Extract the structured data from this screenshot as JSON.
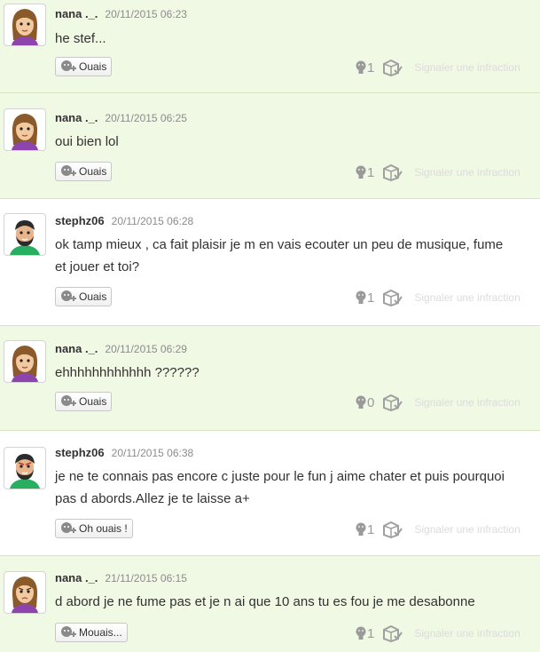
{
  "posts": [
    {
      "author": "nana ._.",
      "timestamp": "20/11/2015 06:23",
      "text": "he stef...",
      "reaction_label": "Ouais",
      "empathy_count": "1",
      "report_label": "Signaler une infraction",
      "avatar": "female-mii-avatar",
      "bg": "green"
    },
    {
      "author": "nana ._.",
      "timestamp": "20/11/2015 06:25",
      "text": "oui bien lol",
      "reaction_label": "Ouais",
      "empathy_count": "1",
      "report_label": "Signaler une infraction",
      "avatar": "female-mii-avatar",
      "bg": "green"
    },
    {
      "author": "stephz06",
      "timestamp": "20/11/2015 06:28",
      "text": "ok tamp mieux , ca fait plaisir je m en vais ecouter un peu de musique, fume et jouer et toi?",
      "reaction_label": "Ouais",
      "empathy_count": "1",
      "report_label": "Signaler une infraction",
      "avatar": "male-mii-avatar",
      "bg": "white"
    },
    {
      "author": "nana ._.",
      "timestamp": "20/11/2015 06:29",
      "text": "ehhhhhhhhhhhh ??????",
      "reaction_label": "Ouais",
      "empathy_count": "0",
      "report_label": "Signaler une infraction",
      "avatar": "female-mii-avatar",
      "bg": "green"
    },
    {
      "author": "stephz06",
      "timestamp": "20/11/2015 06:38",
      "text": "je ne te connais pas encore c juste pour le fun j aime chater et puis pourquoi pas d abords.Allez je te laisse a+",
      "reaction_label": "Oh ouais !",
      "empathy_count": "1",
      "report_label": "Signaler une infraction",
      "avatar": "male-mii-avatar",
      "bg": "white"
    },
    {
      "author": "nana ._.",
      "timestamp": "21/11/2015 06:15",
      "text": "d abord je ne fume pas et je n ai que 10 ans tu es fou je me desabonne",
      "reaction_label": "Mouais...",
      "empathy_count": "1",
      "report_label": "Signaler une infraction",
      "avatar": "female-mii-avatar",
      "bg": "green"
    }
  ],
  "colors": {
    "green_bg": "#f0f9e4",
    "white_bg": "#ffffff",
    "muted_text": "#8c8c8c",
    "report_text": "#dcdcdc"
  }
}
